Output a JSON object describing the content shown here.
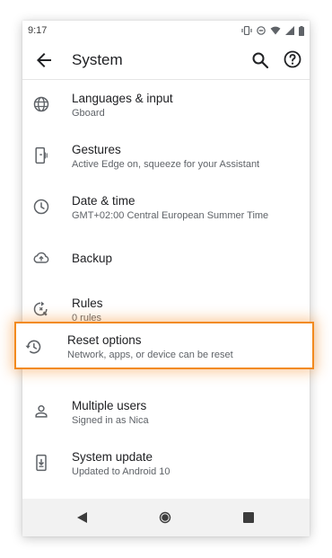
{
  "status_bar": {
    "time": "9:17"
  },
  "app_bar": {
    "title": "System"
  },
  "items": [
    {
      "title": "Languages & input",
      "subtitle": "Gboard",
      "icon": "globe-icon"
    },
    {
      "title": "Gestures",
      "subtitle": "Active Edge on, squeeze for your Assistant",
      "icon": "gesture-phone-icon"
    },
    {
      "title": "Date & time",
      "subtitle": "GMT+02:00 Central European Summer Time",
      "icon": "clock-icon"
    },
    {
      "title": "Backup",
      "subtitle": "",
      "icon": "cloud-upload-icon"
    },
    {
      "title": "Rules",
      "subtitle": "0 rules",
      "icon": "rules-icon"
    },
    {
      "title": "Reset options",
      "subtitle": "Network, apps, or device can be reset",
      "icon": "history-icon"
    },
    {
      "title": "Multiple users",
      "subtitle": "Signed in as Nica",
      "icon": "person-icon"
    },
    {
      "title": "System update",
      "subtitle": "Updated to Android 10",
      "icon": "system-update-icon"
    }
  ],
  "highlight_color": "#f28a1e"
}
